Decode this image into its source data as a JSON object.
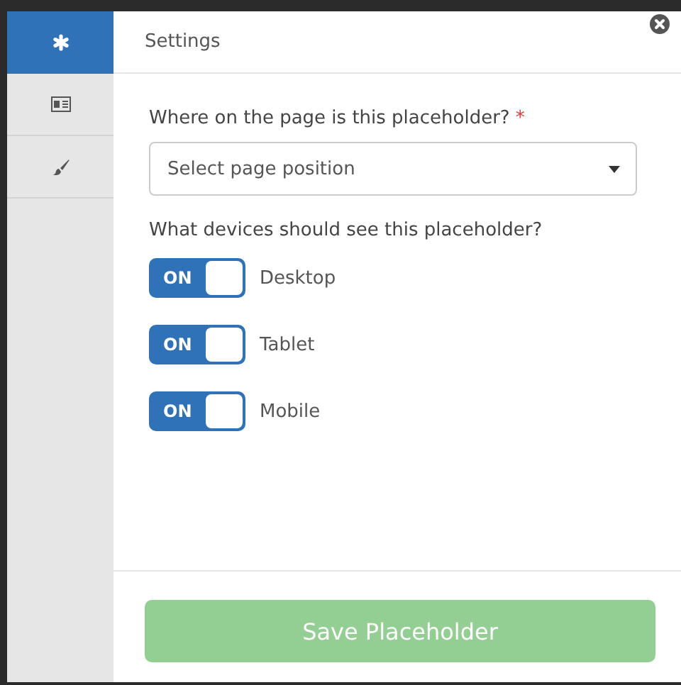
{
  "sidebar": {
    "tabs": [
      {
        "kind": "asterisk",
        "selected": true
      },
      {
        "kind": "card",
        "selected": false
      },
      {
        "kind": "brush",
        "selected": false
      }
    ]
  },
  "header": {
    "title": "Settings"
  },
  "position": {
    "label": "Where on the page is this placeholder?",
    "required_mark": "*",
    "placeholder": "Select page position"
  },
  "devices": {
    "label": "What devices should see this placeholder?",
    "items": [
      {
        "name": "Desktop",
        "on": true,
        "state_text": "ON"
      },
      {
        "name": "Tablet",
        "on": true,
        "state_text": "ON"
      },
      {
        "name": "Mobile",
        "on": true,
        "state_text": "ON"
      }
    ]
  },
  "save_button": {
    "label": "Save Placeholder",
    "disabled": true
  }
}
